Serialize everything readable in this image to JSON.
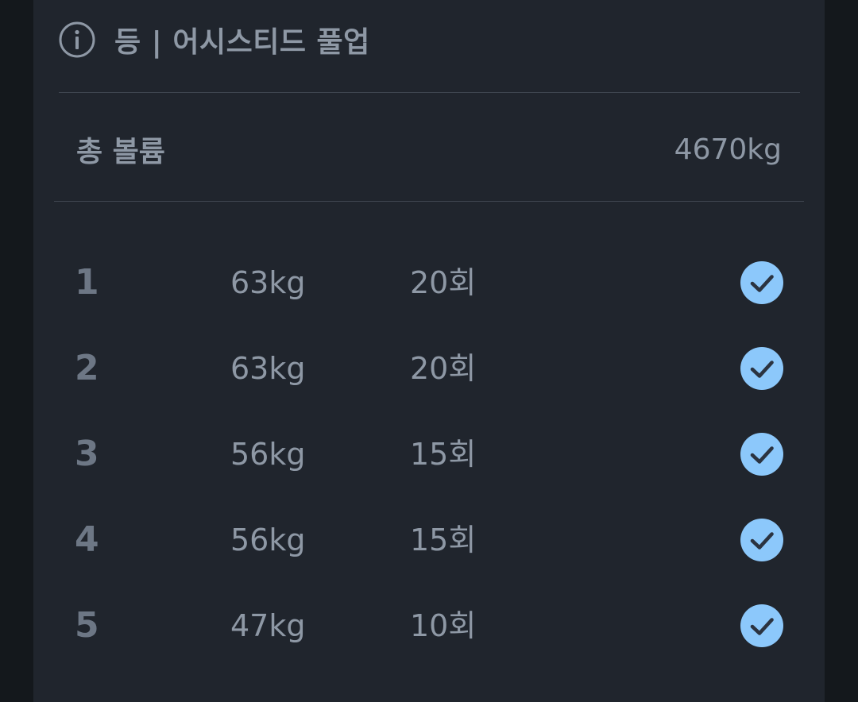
{
  "header": {
    "title": "등 | 어시스티드 풀업",
    "icon": "info-icon"
  },
  "summary": {
    "volume_label": "총 볼륨",
    "volume_value": "4670kg"
  },
  "sets": [
    {
      "number": "1",
      "weight": "63kg",
      "reps": "20회",
      "completed": true
    },
    {
      "number": "2",
      "weight": "63kg",
      "reps": "20회",
      "completed": true
    },
    {
      "number": "3",
      "weight": "56kg",
      "reps": "15회",
      "completed": true
    },
    {
      "number": "4",
      "weight": "56kg",
      "reps": "15회",
      "completed": true
    },
    {
      "number": "5",
      "weight": "47kg",
      "reps": "10회",
      "completed": true
    }
  ],
  "colors": {
    "background": "#14181c",
    "card": "#20252d",
    "text": "#8e98a5",
    "set_number": "#6d7785",
    "check_fill": "#8cc8fb",
    "check_mark": "#2b3340"
  }
}
